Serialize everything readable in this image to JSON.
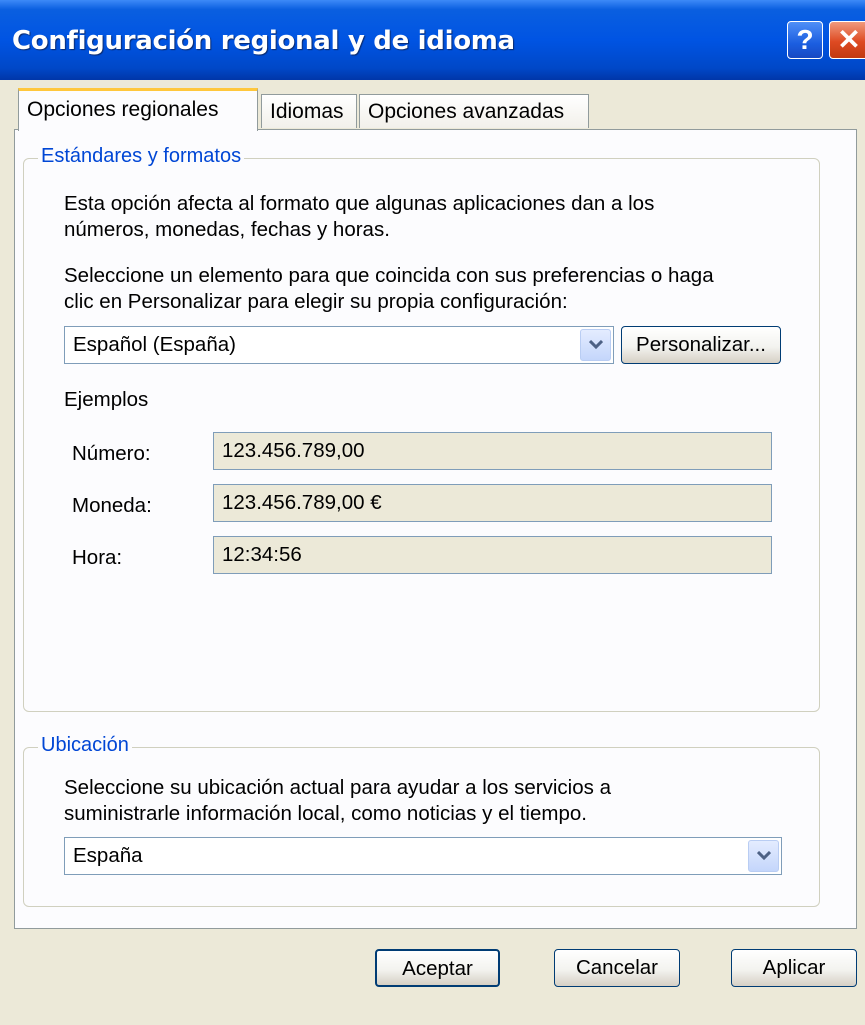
{
  "window": {
    "title": "Configuración regional y de idioma",
    "help_icon": "?",
    "close_icon": "✕"
  },
  "tabs": [
    {
      "label": "Opciones regionales",
      "active": true
    },
    {
      "label": "Idiomas",
      "active": false
    },
    {
      "label": "Opciones avanzadas",
      "active": false
    }
  ],
  "standards": {
    "legend": "Estándares y formatos",
    "description_line1": "Esta opción afecta al formato que algunas aplicaciones dan a los",
    "description_line2": "números, monedas, fechas y horas.",
    "select_line1": "Seleccione un elemento para que coincida con sus preferencias o haga",
    "select_line2": "clic en Personalizar para elegir su propia configuración:",
    "locale_value": "Español (España)",
    "customize_label": "Personalizar...",
    "examples_label": "Ejemplos",
    "examples": [
      {
        "label": "Número:",
        "value": "123.456.789,00"
      },
      {
        "label": "Moneda:",
        "value": "123.456.789,00 €"
      },
      {
        "label": "Hora:",
        "value": "12:34:56"
      }
    ]
  },
  "location": {
    "legend": "Ubicación",
    "description_line1": "Seleccione su ubicación actual para ayudar a los servicios a",
    "description_line2": "suministrarle información local, como noticias y el tiempo.",
    "value": "España"
  },
  "buttons": {
    "ok": "Aceptar",
    "cancel": "Cancelar",
    "apply": "Aplicar"
  },
  "colors": {
    "title_bar": "#0054e3",
    "group_legend": "#0046d5",
    "dialog_bg": "#ece9d8",
    "active_tab_accent": "#ffc73c"
  }
}
